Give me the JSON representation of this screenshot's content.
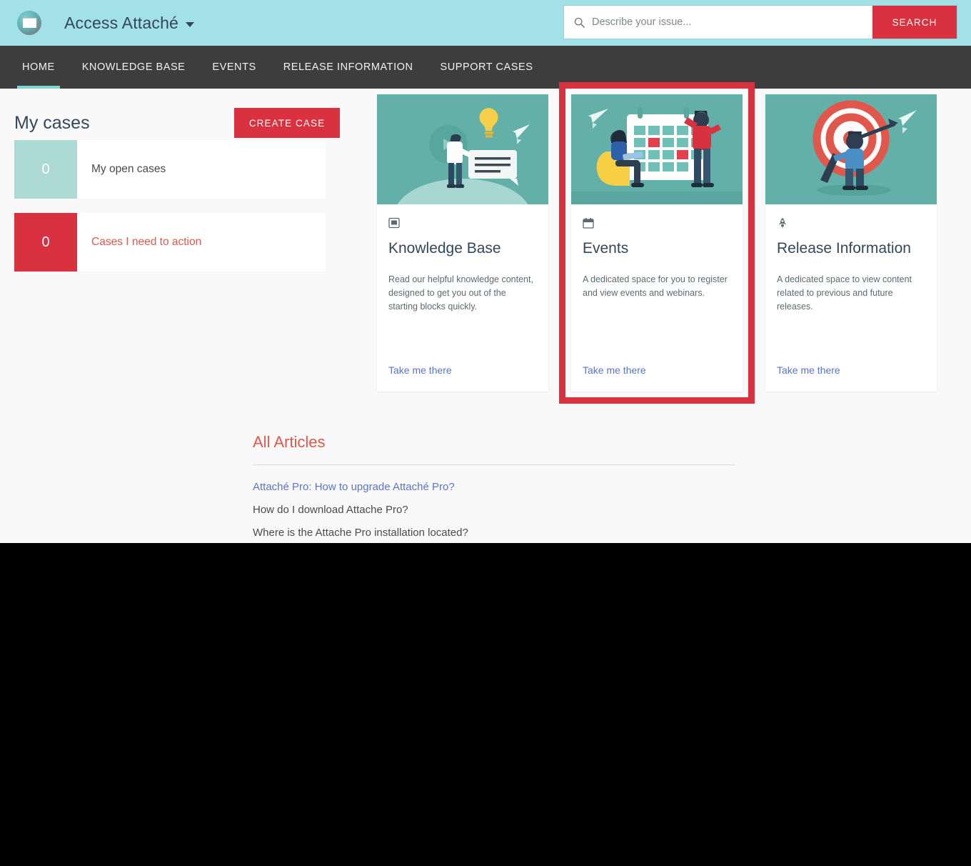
{
  "header": {
    "logo_icon": "access-attache-logo-icon",
    "brand": "Access Attaché",
    "caret_icon": "chevron-down-icon",
    "search": {
      "icon": "search-icon",
      "placeholder": "Describe your issue...",
      "value": "",
      "button_label": "SEARCH",
      "button_color": "#d9313f"
    },
    "background_color": "#a3e1e8"
  },
  "nav": {
    "background_color": "#3d3d3d",
    "active_indicator_color": "#7fd4cc",
    "items": [
      {
        "label": "HOME",
        "active": true
      },
      {
        "label": "KNOWLEDGE BASE",
        "active": false
      },
      {
        "label": "EVENTS",
        "active": false
      },
      {
        "label": "RELEASE INFORMATION",
        "active": false
      },
      {
        "label": "SUPPORT CASES",
        "active": false
      }
    ]
  },
  "my_cases": {
    "title": "My cases",
    "create_button": "CREATE CASE",
    "rows": [
      {
        "count": "0",
        "label": "My open cases",
        "count_color": "#aedad6",
        "label_color": "#4a4a4a"
      },
      {
        "count": "0",
        "label": "Cases I need to action",
        "count_color": "#d9313f",
        "label_color": "#e2574c"
      }
    ]
  },
  "cards": [
    {
      "icon": "book-icon",
      "title": "Knowledge Base",
      "description": "Read our helpful knowledge content, designed to get you out of the starting blocks quickly.",
      "link": "Take me there",
      "illustration": "person-with-lightbulb-illustration",
      "highlighted": false
    },
    {
      "icon": "calendar-icon",
      "title": "Events",
      "description": "A dedicated space for you to register and view events and webinars.",
      "link": "Take me there",
      "illustration": "people-with-calendar-illustration",
      "highlighted": true
    },
    {
      "icon": "rocket-icon",
      "title": "Release Information",
      "description": "A dedicated space to view content related to previous and future releases.",
      "link": "Take me there",
      "illustration": "person-with-target-illustration",
      "highlighted": false
    }
  ],
  "articles": {
    "heading": "All Articles",
    "featured": "Attaché Pro: How to upgrade Attaché Pro?",
    "items": [
      "How do I download Attache Pro?",
      "Where is the Attache Pro installation located?"
    ]
  },
  "annotation": {
    "highlight_color": "#d9313f",
    "target": "Events card"
  }
}
